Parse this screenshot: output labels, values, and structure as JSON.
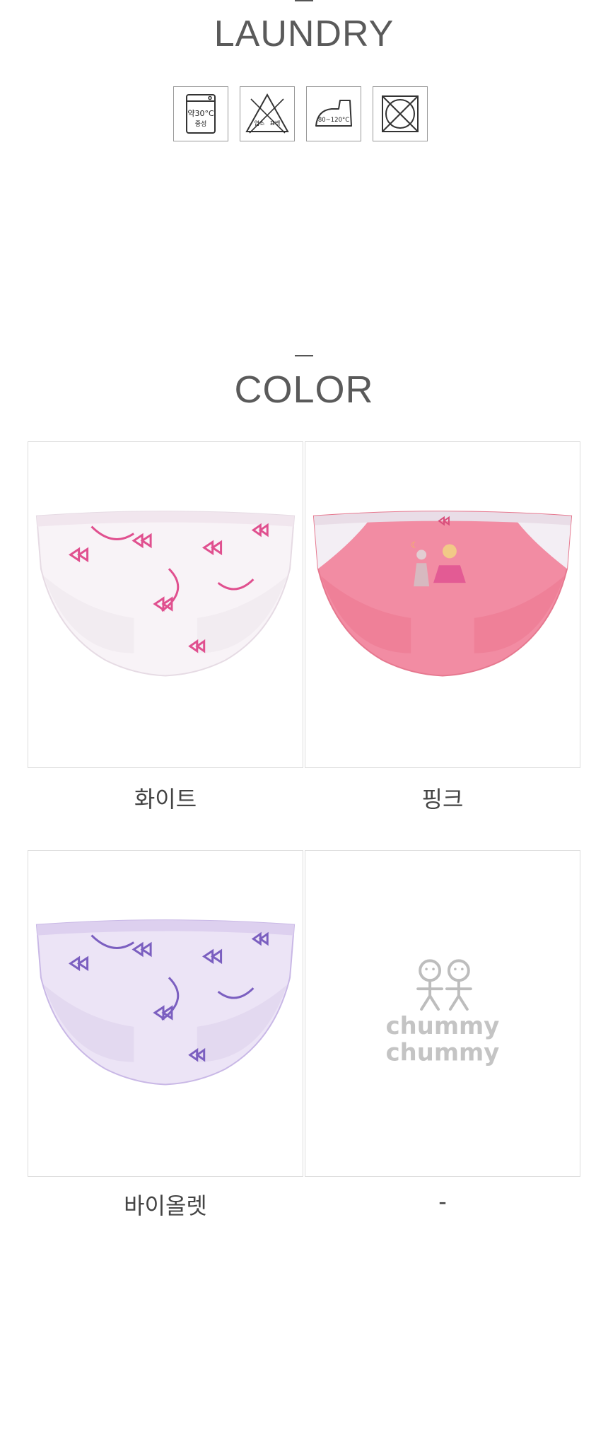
{
  "laundry": {
    "title": "LAUNDRY",
    "icons": [
      {
        "name": "wash-30c-neutral-icon",
        "line1": "약30°C",
        "line2": "중성"
      },
      {
        "name": "no-bleach-icon",
        "text_left": "염소",
        "text_right": "표백"
      },
      {
        "name": "iron-80-120c-icon",
        "text": "80~120°C"
      },
      {
        "name": "no-tumble-dry-icon"
      }
    ]
  },
  "color": {
    "title": "COLOR",
    "items": [
      {
        "label": "화이트",
        "swatch": "#f7f2f6",
        "accent": "#e0508f"
      },
      {
        "label": "핑크",
        "swatch": "#f08aa0",
        "accent": "#d94f7c"
      },
      {
        "label": "바이올렛",
        "swatch": "#ebe3f5",
        "accent": "#7b5fc0"
      },
      {
        "label": "-",
        "logo_line1": "chummy",
        "logo_line2": "chummy"
      }
    ]
  }
}
